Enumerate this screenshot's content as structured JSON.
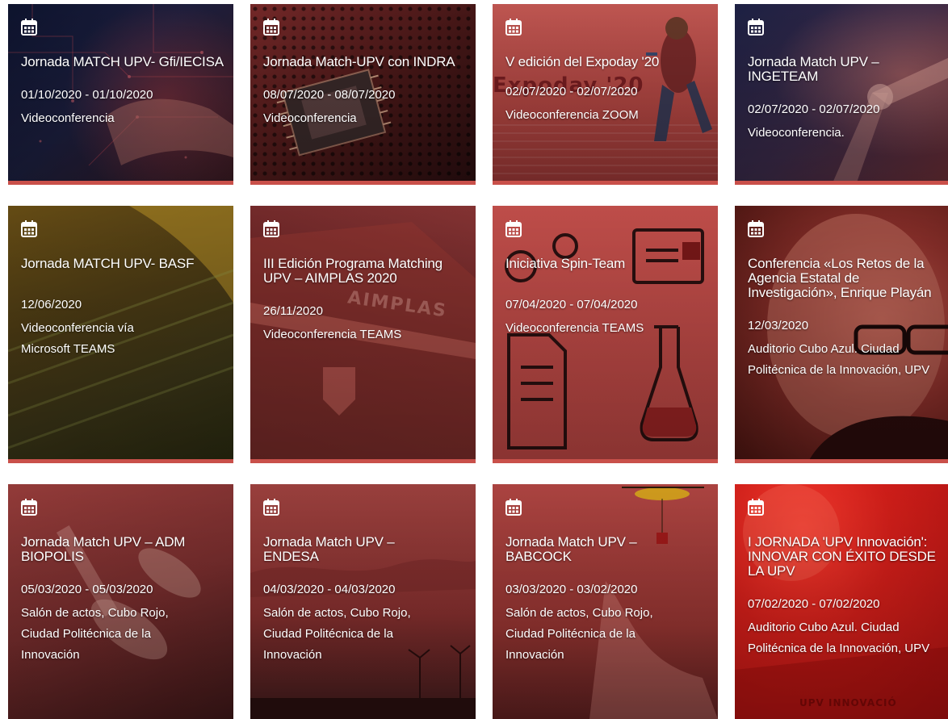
{
  "icon": "calendar-icon",
  "accent": "#c9504a",
  "events": [
    {
      "title": "Jornada MATCH UPV- Gfi/IECISA",
      "date": "01/10/2020 - 01/10/2020",
      "place": "Videoconferencia"
    },
    {
      "title": "Jornada Match-UPV con INDRA",
      "date": "08/07/2020 - 08/07/2020",
      "place": "Videoconferencia"
    },
    {
      "title": "V edición del Expoday '20",
      "date": "02/07/2020 - 02/07/2020",
      "place": "Videoconferencia ZOOM",
      "image_text": "Expoday '20"
    },
    {
      "title": "Jornada Match UPV – INGETEAM",
      "date": "02/07/2020 - 02/07/2020",
      "place": "Videoconferencia."
    },
    {
      "title": "Jornada MATCH UPV- BASF",
      "date": "12/06/2020",
      "place": "Videoconferencia vía Microsoft TEAMS"
    },
    {
      "title": "III Edición Programa Matching UPV – AIMPLAS 2020",
      "date": "26/11/2020",
      "place": "Videoconferencia TEAMS",
      "image_text": "AIMPLAS"
    },
    {
      "title": "Iniciativa Spin-Team",
      "date": "07/04/2020 - 07/04/2020",
      "place": "Videoconferencia TEAMS"
    },
    {
      "title": "Conferencia «Los Retos de la Agencia Estatal de Investigación», Enrique Playán",
      "date": "12/03/2020",
      "place": "Auditorio Cubo Azul. Ciudad Politécnica de la Innovación, UPV"
    },
    {
      "title": "Jornada Match UPV – ADM BIOPOLIS",
      "date": "05/03/2020 - 05/03/2020",
      "place": "Salón de actos, Cubo Rojo, Ciudad Politécnica de la Innovación"
    },
    {
      "title": "Jornada Match UPV – ENDESA",
      "date": "04/03/2020 - 04/03/2020",
      "place": "Salón de actos, Cubo Rojo, Ciudad Politécnica de la Innovación"
    },
    {
      "title": "Jornada Match UPV – BABCOCK",
      "date": "03/03/2020 - 03/02/2020",
      "place": "Salón de actos, Cubo Rojo, Ciudad Politécnica de la Innovación"
    },
    {
      "title": "I JORNADA 'UPV Innovación': INNOVAR CON ÉXITO DESDE LA UPV",
      "date": "07/02/2020 - 07/02/2020",
      "place": "Auditorio Cubo Azul. Ciudad Politécnica de la Innovación, UPV",
      "image_text": "UPV INNOVACIÓ"
    }
  ]
}
